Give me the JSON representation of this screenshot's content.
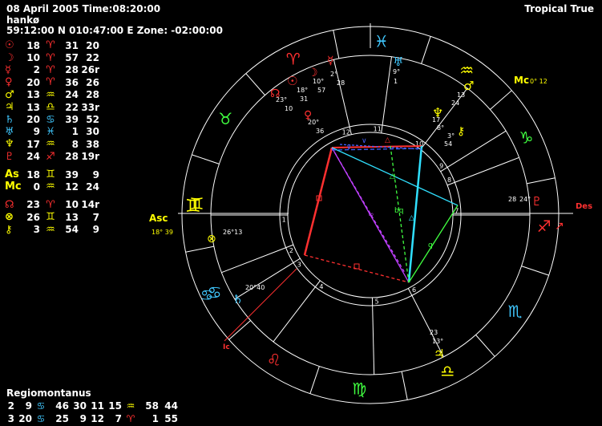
{
  "header": {
    "line1": "08 April 2005 Time:08:20:00",
    "line2": "hankø",
    "line3": "59:12:00 N 010:47:00 E Zone: -02:00:00",
    "zodiac_type": "Tropical True"
  },
  "planets": [
    {
      "name": "sun-glyph",
      "sym": "☉",
      "symColor": "#ff3030",
      "deg": "18",
      "sign": "♈",
      "signColor": "#ff3030",
      "min": "31",
      "sec": "20"
    },
    {
      "name": "moon-glyph",
      "sym": "☽",
      "symColor": "#ff3030",
      "deg": "10",
      "sign": "♈",
      "signColor": "#ff3030",
      "min": "57",
      "sec": "22"
    },
    {
      "name": "mercury-glyph",
      "sym": "☿",
      "symColor": "#ff3030",
      "deg": "2",
      "sign": "♈",
      "signColor": "#ff3030",
      "min": "28",
      "sec": "26r"
    },
    {
      "name": "venus-glyph",
      "sym": "♀",
      "symColor": "#ff3030",
      "deg": "20",
      "sign": "♈",
      "signColor": "#ff3030",
      "min": "36",
      "sec": "26"
    },
    {
      "name": "mars-glyph",
      "sym": "♂",
      "symColor": "#ffff00",
      "deg": "13",
      "sign": "♒",
      "signColor": "#ffff00",
      "min": "24",
      "sec": "28"
    },
    {
      "name": "jupiter-glyph",
      "sym": "♃",
      "symColor": "#ffff00",
      "deg": "13",
      "sign": "♎",
      "signColor": "#ffff00",
      "min": "22",
      "sec": "33r"
    },
    {
      "name": "saturn-glyph",
      "sym": "♄",
      "symColor": "#40c8ff",
      "deg": "20",
      "sign": "♋",
      "signColor": "#40c8ff",
      "min": "39",
      "sec": "52"
    },
    {
      "name": "uranus-glyph",
      "sym": "♅",
      "symColor": "#40c8ff",
      "deg": "9",
      "sign": "♓",
      "signColor": "#40c8ff",
      "min": "1",
      "sec": "30"
    },
    {
      "name": "neptune-glyph",
      "sym": "♆",
      "symColor": "#ffff00",
      "deg": "17",
      "sign": "♒",
      "signColor": "#ffff00",
      "min": "8",
      "sec": "38"
    },
    {
      "name": "pluto-glyph",
      "sym": "♇",
      "symColor": "#ff3030",
      "deg": "24",
      "sign": "♐",
      "signColor": "#ff3030",
      "min": "28",
      "sec": "19r"
    },
    {
      "name": "ascendant-label",
      "sym": "As",
      "symColor": "#ffff00",
      "deg": "18",
      "sign": "♊",
      "signColor": "#ffff00",
      "min": "39",
      "sec": "9",
      "gap": true
    },
    {
      "name": "midheaven-label",
      "sym": "Mc",
      "symColor": "#ffff00",
      "deg": "0",
      "sign": "♒",
      "signColor": "#ffff00",
      "min": "12",
      "sec": "24"
    },
    {
      "name": "node-glyph",
      "sym": "☊",
      "symColor": "#ff3030",
      "deg": "23",
      "sign": "♈",
      "signColor": "#ff3030",
      "min": "10",
      "sec": "14r",
      "gap": true
    },
    {
      "name": "part-of-fortune-glyph",
      "sym": "⊗",
      "symColor": "#ffff00",
      "deg": "26",
      "sign": "♊",
      "signColor": "#ffff00",
      "min": "13",
      "sec": "7"
    },
    {
      "name": "chiron-glyph",
      "sym": "⚷",
      "symColor": "#ffff00",
      "deg": "3",
      "sign": "♒",
      "signColor": "#ffff00",
      "min": "54",
      "sec": "9"
    }
  ],
  "houses": {
    "title": "Regiomontanus",
    "rows": [
      {
        "a": "2",
        "b": "9",
        "s1": "♋",
        "s1c": "#40c8ff",
        "c": "46",
        "d": "30",
        "e": "11",
        "f": "15",
        "s2": "♒",
        "s2c": "#ffff00",
        "g": "58",
        "h": "44"
      },
      {
        "a": "3",
        "b": "20",
        "s1": "♋",
        "s1c": "#40c8ff",
        "c": "25",
        "d": "9",
        "e": "12",
        "f": "7",
        "s2": "♈",
        "s2c": "#ff3030",
        "g": "1",
        "h": "55"
      }
    ]
  },
  "wheel": {
    "signs": [
      {
        "name": "aries",
        "glyph": "♈",
        "color": "#ff3030"
      },
      {
        "name": "taurus",
        "glyph": "♉",
        "color": "#40ff40"
      },
      {
        "name": "gemini",
        "glyph": "♊",
        "color": "#ffff00"
      },
      {
        "name": "cancer",
        "glyph": "♋",
        "color": "#40c8ff"
      },
      {
        "name": "leo",
        "glyph": "♌",
        "color": "#ff3030"
      },
      {
        "name": "virgo",
        "glyph": "♍",
        "color": "#40ff40"
      },
      {
        "name": "libra",
        "glyph": "♎",
        "color": "#ffff00"
      },
      {
        "name": "scorpio",
        "glyph": "♏",
        "color": "#40c8ff"
      },
      {
        "name": "sagittarius",
        "glyph": "♐",
        "color": "#ff3030"
      },
      {
        "name": "capricorn",
        "glyph": "♑",
        "color": "#40ff40"
      },
      {
        "name": "aquarius",
        "glyph": "♒",
        "color": "#ffff00"
      },
      {
        "name": "pisces",
        "glyph": "♓",
        "color": "#40c8ff"
      }
    ],
    "asc_label": "Asc",
    "asc_value": "18° 39",
    "mc_label": "Mc",
    "mc_value": "0° 12",
    "des_label": "Des",
    "ic_label": "Ic",
    "pof_value": "26°13",
    "pluto_value": "28",
    "pluto_deg": "24°",
    "saturn_value": "20°40",
    "jupiter_value_1": "23",
    "jupiter_value_2": "13°",
    "neptune_value_1": "17",
    "neptune_value_2": "8°",
    "mars_value_1": "13",
    "mars_value_2": "24",
    "chiron_value_1": "3°",
    "chiron_value_2": "54",
    "uranus_value_1": "9°",
    "uranus_value_2": "1",
    "mercury_value_1": "2°",
    "mercury_value_2": "28",
    "moon_value_1": "10°",
    "moon_value_2": "57",
    "sun_value_1": "18°",
    "sun_value_2": "31",
    "node_value_1": "23°",
    "node_value_2": "10",
    "venus_value_1": "20°",
    "venus_value_2": "36",
    "house_numbers": [
      "1",
      "2",
      "3",
      "4",
      "5",
      "6",
      "7",
      "8",
      "9",
      "10",
      "11",
      "12"
    ]
  }
}
